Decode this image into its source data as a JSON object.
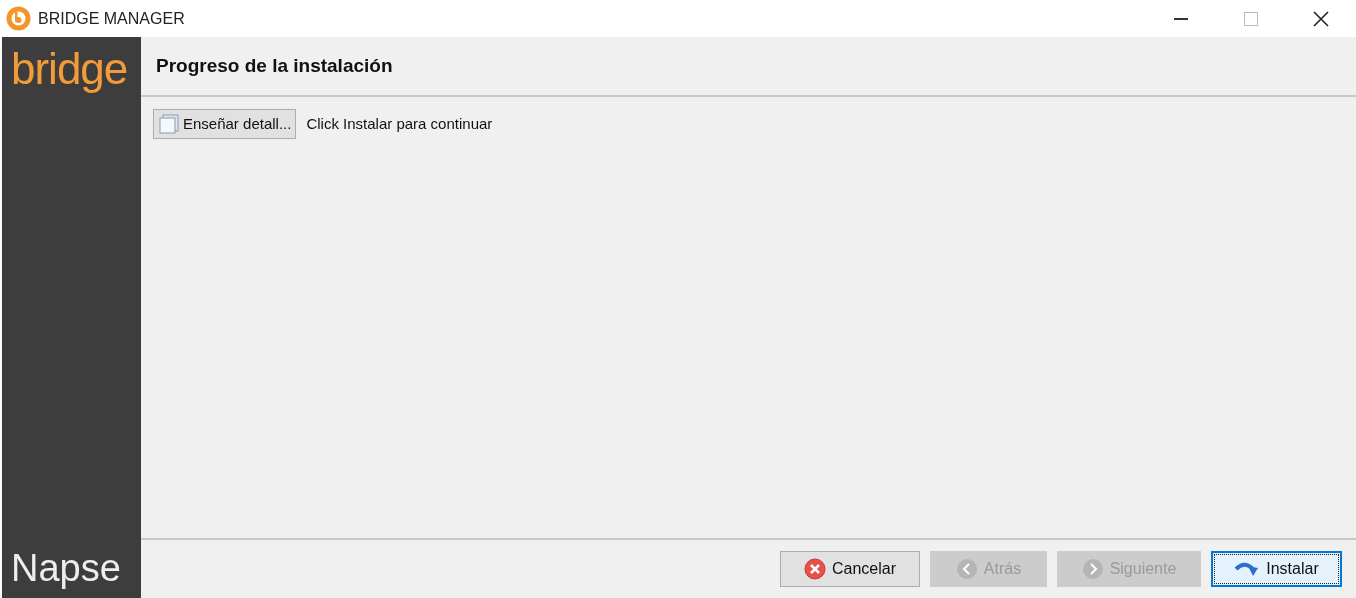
{
  "window": {
    "title": "BRIDGE MANAGER"
  },
  "sidebar": {
    "logo": "bridge",
    "footer": "Napse"
  },
  "header": {
    "title": "Progreso de la instalación"
  },
  "details_button": {
    "label": "Enseñar detall..."
  },
  "status": "Click Instalar para continuar",
  "buttons": [
    {
      "label": "Cancelar",
      "kind": "cancel",
      "disabled": false,
      "focused": false
    },
    {
      "label": "Atrás",
      "kind": "back",
      "disabled": true,
      "focused": false
    },
    {
      "label": "Siguiente",
      "kind": "next",
      "disabled": true,
      "focused": false
    },
    {
      "label": "Instalar",
      "kind": "install",
      "disabled": false,
      "focused": true
    }
  ]
}
